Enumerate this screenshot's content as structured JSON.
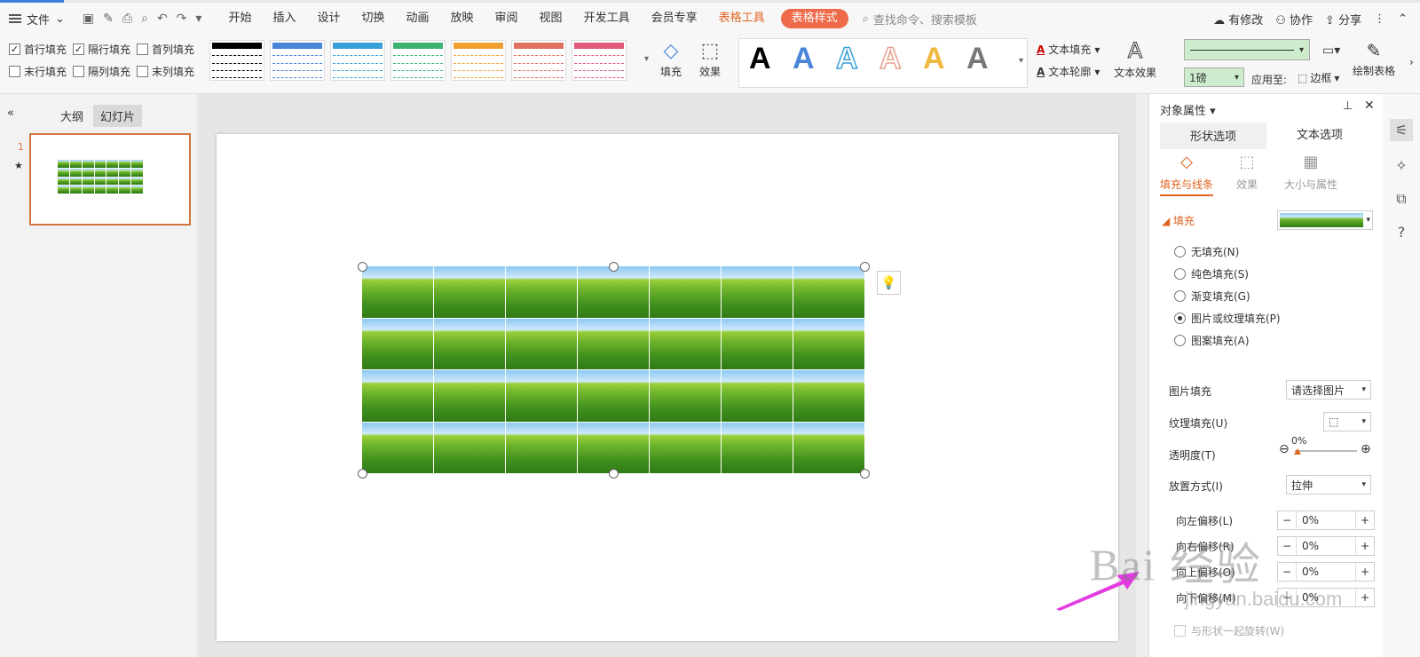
{
  "menubar": {
    "file_label": "文件",
    "tabs": [
      "开始",
      "插入",
      "设计",
      "切换",
      "动画",
      "放映",
      "审阅",
      "视图",
      "开发工具",
      "会员专享"
    ],
    "context_tab": "表格工具",
    "active_tab": "表格样式",
    "search_placeholder": "查找命令、搜索模板",
    "modified_label": "有修改",
    "collab_label": "协作",
    "share_label": "分享"
  },
  "ribbon": {
    "checkboxes": [
      {
        "label": "首行填充",
        "checked": true
      },
      {
        "label": "隔行填充",
        "checked": true
      },
      {
        "label": "首列填充",
        "checked": false
      },
      {
        "label": "末行填充",
        "checked": false
      },
      {
        "label": "隔列填充",
        "checked": false
      },
      {
        "label": "末列填充",
        "checked": false
      }
    ],
    "style_colors": [
      "#000000",
      "#4a86d8",
      "#3aa0d8",
      "#3cb371",
      "#f0a030",
      "#e07060",
      "#e05a7a"
    ],
    "fill_label": "填充",
    "effect_label": "效果",
    "text_fill_label": "文本填充",
    "text_outline_label": "文本轮廓",
    "text_effect_label": "文本效果",
    "line_weight": "1磅",
    "apply_to_label": "应用至:",
    "border_label": "边框",
    "draw_table_label": "绘制表格"
  },
  "sidebar": {
    "outline_label": "大纲",
    "slides_label": "幻灯片",
    "slide_number": "1"
  },
  "panel": {
    "title": "对象属性",
    "tabs": [
      "形状选项",
      "文本选项"
    ],
    "subtabs": [
      "填充与线条",
      "效果",
      "大小与属性"
    ],
    "fill_section": "填充",
    "fill_options": [
      {
        "label": "无填充(N)",
        "selected": false
      },
      {
        "label": "纯色填充(S)",
        "selected": false
      },
      {
        "label": "渐变填充(G)",
        "selected": false
      },
      {
        "label": "图片或纹理填充(P)",
        "selected": true
      },
      {
        "label": "图案填充(A)",
        "selected": false
      }
    ],
    "picture_fill_label": "图片填充",
    "picture_fill_value": "请选择图片",
    "texture_fill_label": "纹理填充(U)",
    "transparency_label": "透明度(T)",
    "transparency_value": "0%",
    "placement_label": "放置方式(I)",
    "placement_value": "拉伸",
    "offsets": [
      {
        "label": "向左偏移(L)",
        "value": "0%"
      },
      {
        "label": "向右偏移(R)",
        "value": "0%"
      },
      {
        "label": "向上偏移(O)",
        "value": "0%"
      },
      {
        "label": "向下偏移(M)",
        "value": "0%"
      }
    ],
    "rotate_label": "与形状一起旋转(W)"
  },
  "watermark": {
    "line1": "Bai 经验",
    "line2": "jingyan.baidu.com"
  }
}
